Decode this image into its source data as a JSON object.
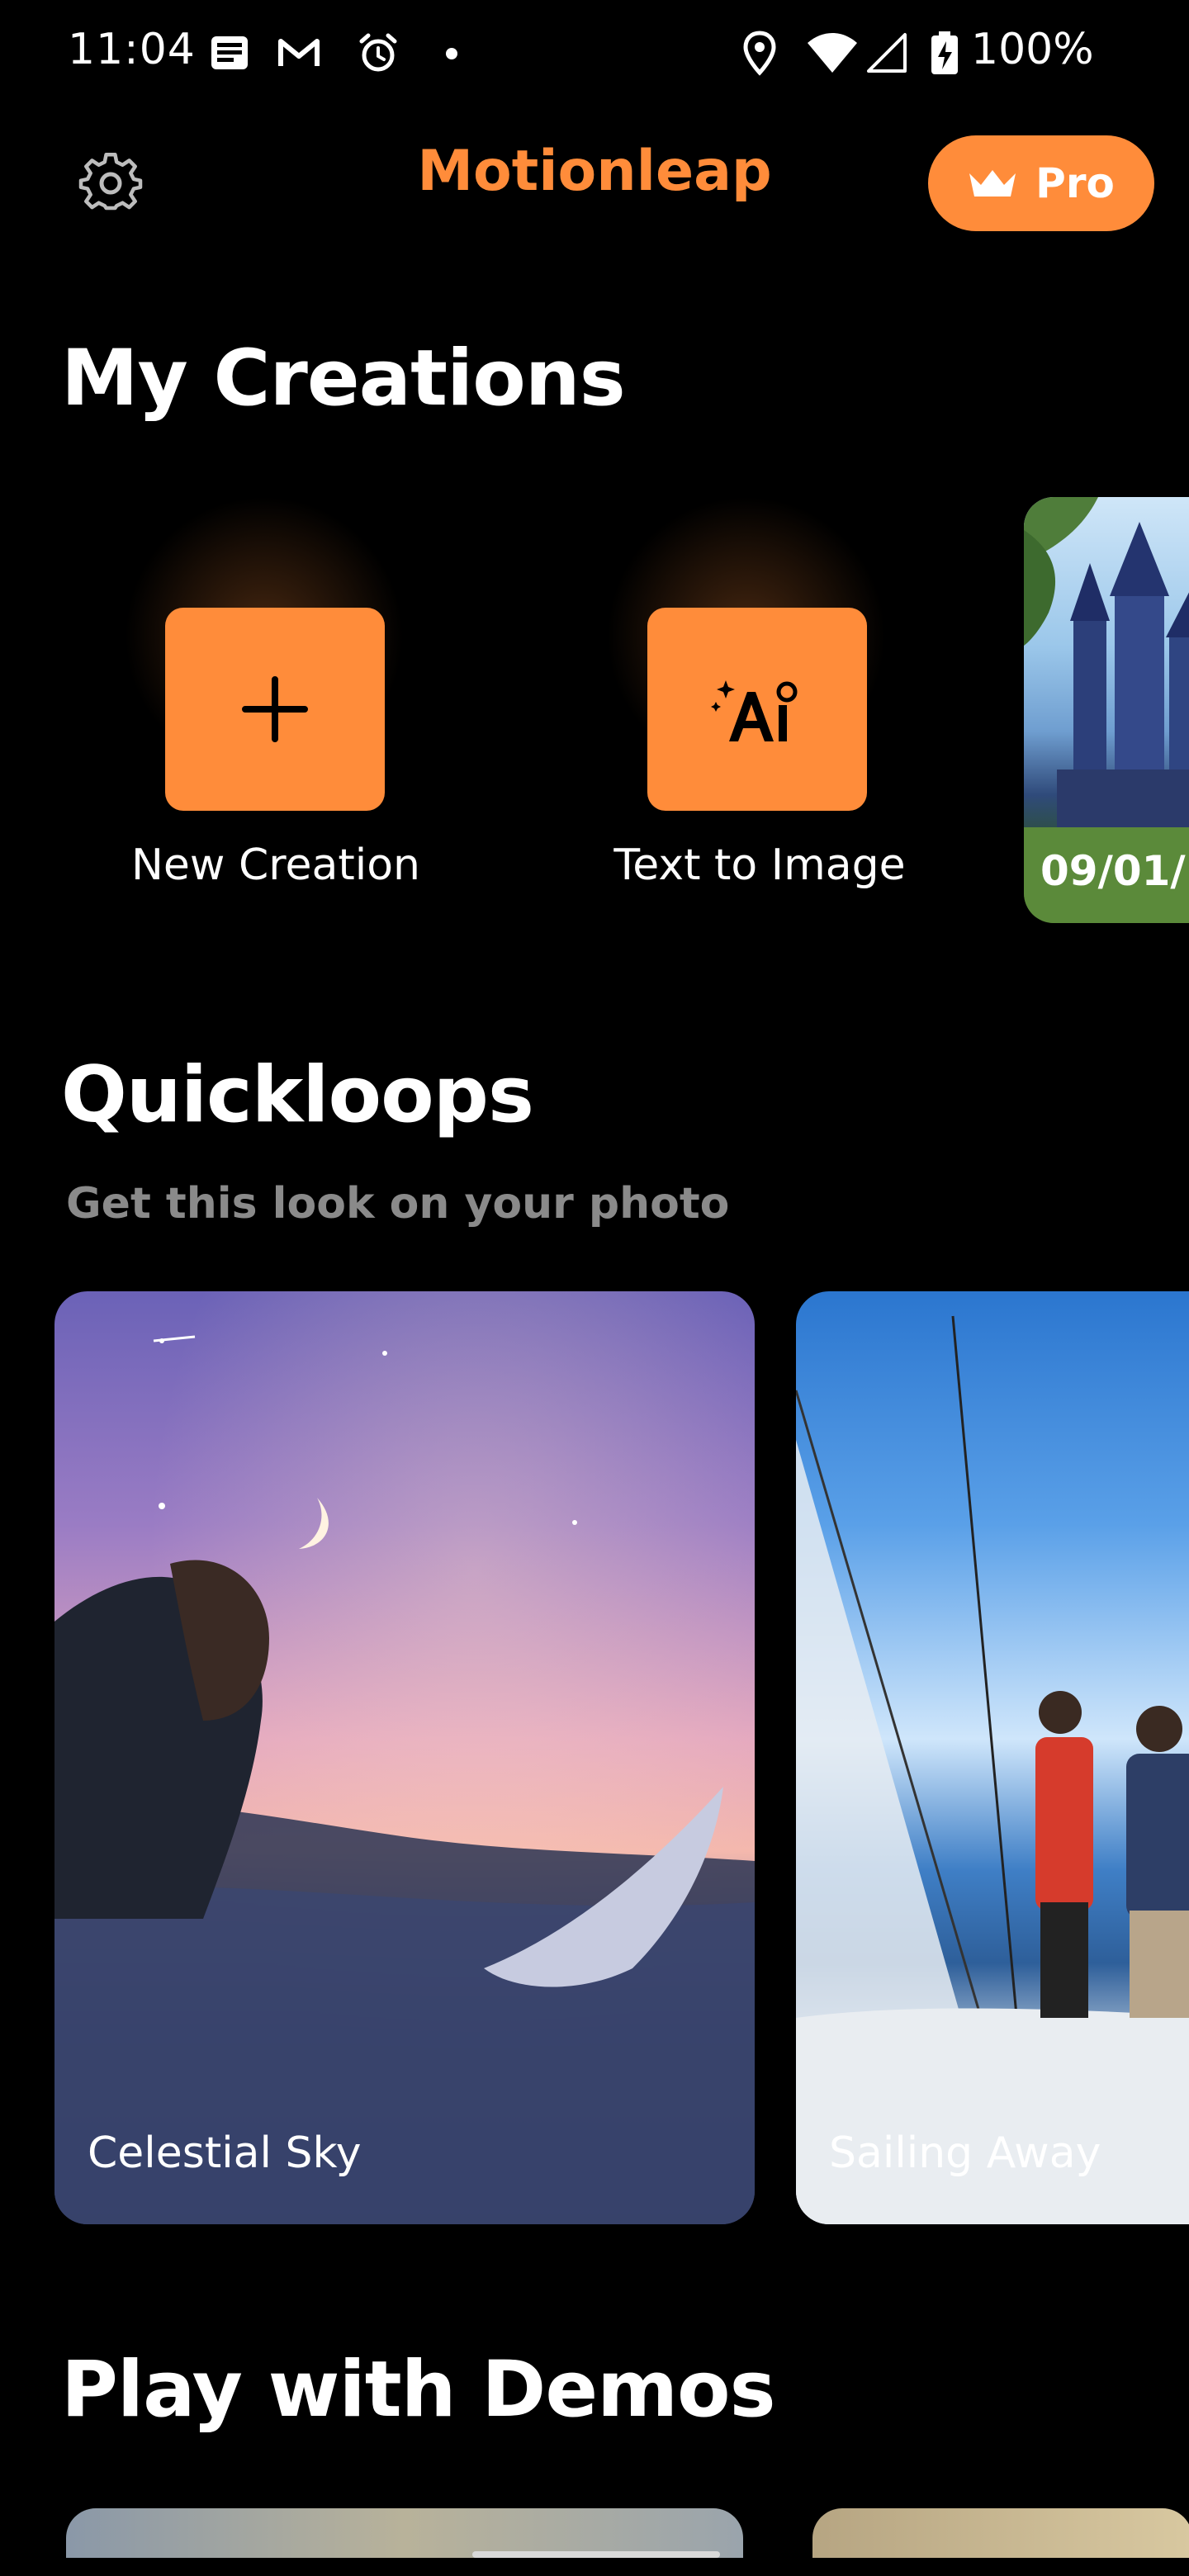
{
  "status_bar": {
    "time": "11:04",
    "battery": "100%"
  },
  "app_bar": {
    "title": "Motionleap",
    "pro_label": "Pro",
    "accent": "#ff8c3a"
  },
  "my_creations": {
    "title": "My Creations",
    "new_creation_label": "New Creation",
    "text_to_image_label": "Text to Image",
    "recent_date": "09/01/"
  },
  "quickloops": {
    "title": "Quickloops",
    "subtitle": "Get this look on your photo",
    "items": [
      {
        "label": "Celestial Sky"
      },
      {
        "label": "Sailing Away"
      }
    ]
  },
  "demos": {
    "title": "Play with Demos"
  }
}
